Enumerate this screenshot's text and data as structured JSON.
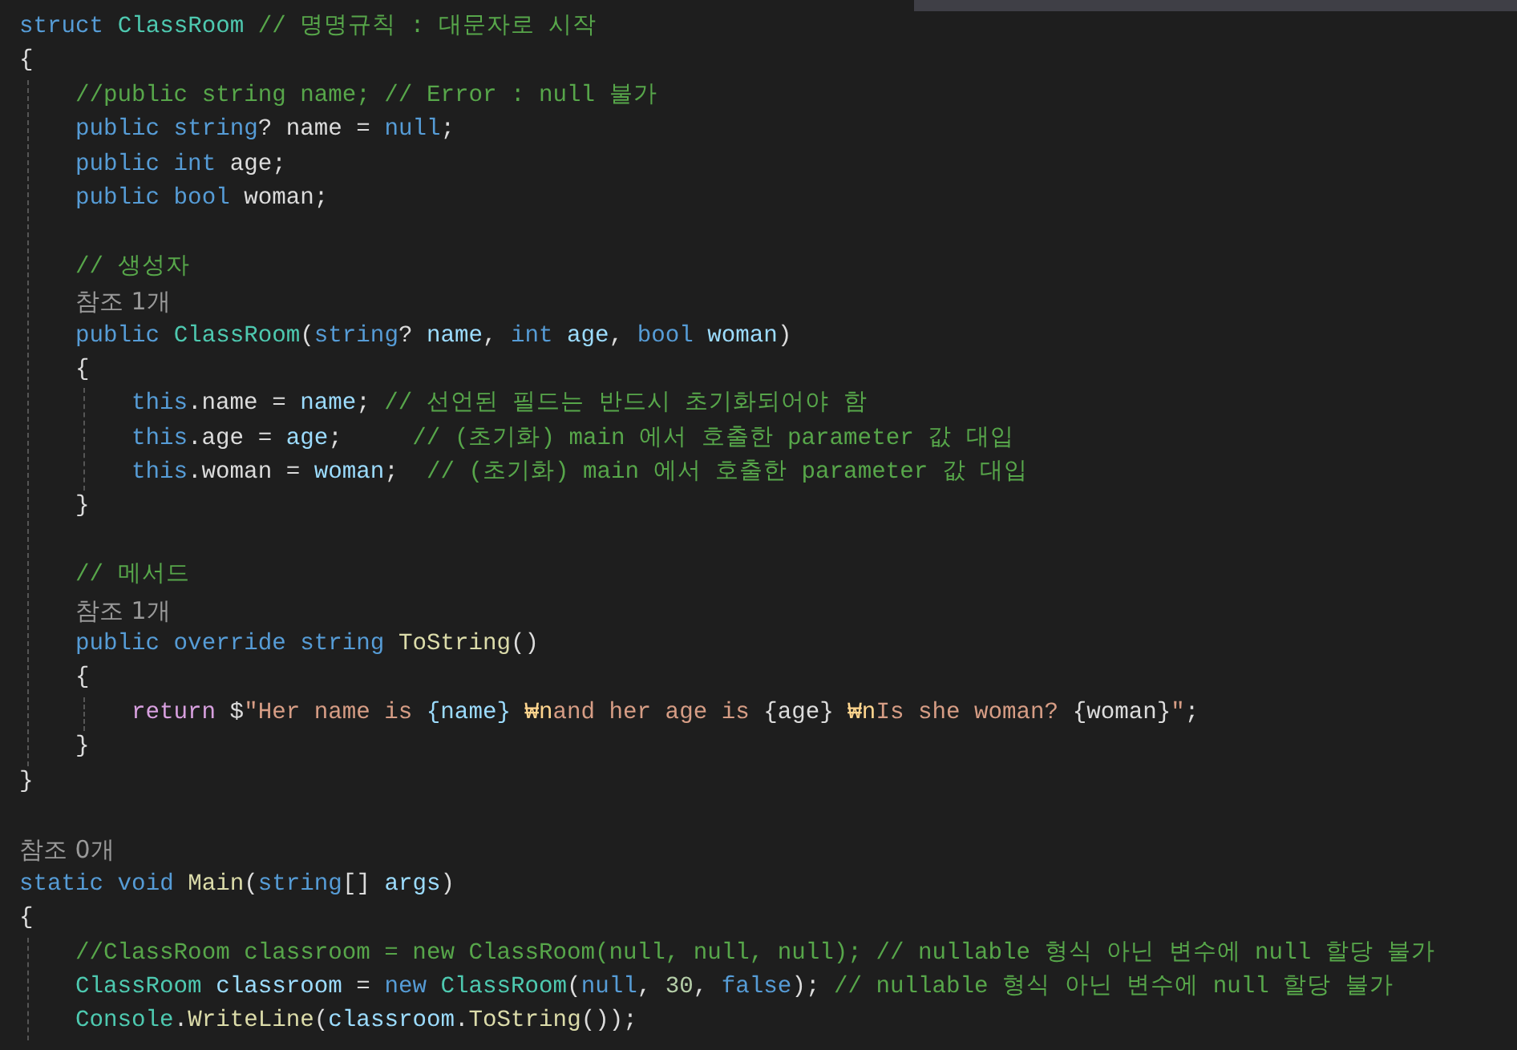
{
  "editor": {
    "lines": [
      {
        "kind": "code",
        "tokens": [
          {
            "kind": "kw",
            "text": "struct "
          },
          {
            "kind": "type",
            "text": "ClassRoom"
          },
          {
            "kind": "comment",
            "text": " // 명명규칙 : 대문자로 시작"
          }
        ]
      },
      {
        "kind": "code",
        "tokens": [
          {
            "kind": "plain",
            "text": "{"
          }
        ],
        "children": [
          {
            "kind": "code",
            "tokens": [
              {
                "kind": "comment",
                "text": "//public string name; // Error : null 불가"
              }
            ]
          },
          {
            "kind": "code",
            "tokens": [
              {
                "kind": "kw",
                "text": "public string"
              },
              {
                "kind": "plain",
                "text": "? name = "
              },
              {
                "kind": "kw",
                "text": "null"
              },
              {
                "kind": "plain",
                "text": ";"
              }
            ]
          },
          {
            "kind": "code",
            "tokens": [
              {
                "kind": "kw",
                "text": "public int"
              },
              {
                "kind": "plain",
                "text": " age;"
              }
            ]
          },
          {
            "kind": "code",
            "tokens": [
              {
                "kind": "kw",
                "text": "public bool"
              },
              {
                "kind": "plain",
                "text": " woman;"
              }
            ]
          },
          {
            "kind": "blank"
          },
          {
            "kind": "code",
            "tokens": [
              {
                "kind": "comment",
                "text": "// 생성자"
              }
            ]
          },
          {
            "kind": "codelens",
            "text": "참조 1개"
          },
          {
            "kind": "code",
            "tokens": [
              {
                "kind": "kw",
                "text": "public "
              },
              {
                "kind": "type",
                "text": "ClassRoom"
              },
              {
                "kind": "plain",
                "text": "("
              },
              {
                "kind": "kw",
                "text": "string"
              },
              {
                "kind": "plain",
                "text": "? "
              },
              {
                "kind": "var",
                "text": "name"
              },
              {
                "kind": "plain",
                "text": ", "
              },
              {
                "kind": "kw",
                "text": "int "
              },
              {
                "kind": "var",
                "text": "age"
              },
              {
                "kind": "plain",
                "text": ", "
              },
              {
                "kind": "kw",
                "text": "bool "
              },
              {
                "kind": "var",
                "text": "woman"
              },
              {
                "kind": "plain",
                "text": ")"
              }
            ]
          },
          {
            "kind": "code",
            "tokens": [
              {
                "kind": "plain",
                "text": "{"
              }
            ],
            "children": [
              {
                "kind": "code",
                "tokens": [
                  {
                    "kind": "kw",
                    "text": "this"
                  },
                  {
                    "kind": "plain",
                    "text": ".name = "
                  },
                  {
                    "kind": "var",
                    "text": "name"
                  },
                  {
                    "kind": "plain",
                    "text": "; "
                  },
                  {
                    "kind": "comment",
                    "text": "// 선언된 필드는 반드시 초기화되어야 함"
                  }
                ]
              },
              {
                "kind": "code",
                "tokens": [
                  {
                    "kind": "kw",
                    "text": "this"
                  },
                  {
                    "kind": "plain",
                    "text": ".age = "
                  },
                  {
                    "kind": "var",
                    "text": "age"
                  },
                  {
                    "kind": "plain",
                    "text": ";     "
                  },
                  {
                    "kind": "comment",
                    "text": "// (초기화) main 에서 호출한 parameter 값 대입"
                  }
                ]
              },
              {
                "kind": "code",
                "tokens": [
                  {
                    "kind": "kw",
                    "text": "this"
                  },
                  {
                    "kind": "plain",
                    "text": ".woman = "
                  },
                  {
                    "kind": "var",
                    "text": "woman"
                  },
                  {
                    "kind": "plain",
                    "text": ";  "
                  },
                  {
                    "kind": "comment",
                    "text": "// (초기화) main 에서 호출한 parameter 값 대입"
                  }
                ]
              }
            ]
          },
          {
            "kind": "code",
            "tokens": [
              {
                "kind": "plain",
                "text": "}"
              }
            ]
          },
          {
            "kind": "blank"
          },
          {
            "kind": "code",
            "tokens": [
              {
                "kind": "comment",
                "text": "// 메서드"
              }
            ]
          },
          {
            "kind": "codelens",
            "text": "참조 1개"
          },
          {
            "kind": "code",
            "tokens": [
              {
                "kind": "kw",
                "text": "public override string "
              },
              {
                "kind": "fn",
                "text": "ToString"
              },
              {
                "kind": "plain",
                "text": "()"
              }
            ]
          },
          {
            "kind": "code",
            "tokens": [
              {
                "kind": "plain",
                "text": "{"
              }
            ],
            "children": [
              {
                "kind": "code",
                "tokens": [
                  {
                    "kind": "ctrl",
                    "text": "return"
                  },
                  {
                    "kind": "plain",
                    "text": " $"
                  },
                  {
                    "kind": "str",
                    "text": "\"Her name is "
                  },
                  {
                    "kind": "var",
                    "text": "{name}"
                  },
                  {
                    "kind": "esc",
                    "text": " ₩n"
                  },
                  {
                    "kind": "str",
                    "text": "and her age is "
                  },
                  {
                    "kind": "plain",
                    "text": "{age}"
                  },
                  {
                    "kind": "esc",
                    "text": " ₩n"
                  },
                  {
                    "kind": "str",
                    "text": "Is she woman? "
                  },
                  {
                    "kind": "plain",
                    "text": "{woman}"
                  },
                  {
                    "kind": "str",
                    "text": "\""
                  },
                  {
                    "kind": "plain",
                    "text": ";"
                  }
                ]
              }
            ]
          },
          {
            "kind": "code",
            "tokens": [
              {
                "kind": "plain",
                "text": "}"
              }
            ]
          }
        ]
      },
      {
        "kind": "code",
        "tokens": [
          {
            "kind": "plain",
            "text": "}"
          }
        ]
      },
      {
        "kind": "blank"
      },
      {
        "kind": "codelens",
        "text": "참조 0개"
      },
      {
        "kind": "code",
        "tokens": [
          {
            "kind": "kw",
            "text": "static void "
          },
          {
            "kind": "fn",
            "text": "Main"
          },
          {
            "kind": "plain",
            "text": "("
          },
          {
            "kind": "kw",
            "text": "string"
          },
          {
            "kind": "plain",
            "text": "[] "
          },
          {
            "kind": "var",
            "text": "args"
          },
          {
            "kind": "plain",
            "text": ")"
          }
        ]
      },
      {
        "kind": "code",
        "tokens": [
          {
            "kind": "plain",
            "text": "{"
          }
        ],
        "children": [
          {
            "kind": "code",
            "tokens": [
              {
                "kind": "comment",
                "text": "//ClassRoom classroom = new ClassRoom(null, null, null); // nullable 형식 아닌 변수에 null 할당 불가"
              }
            ]
          },
          {
            "kind": "code",
            "tokens": [
              {
                "kind": "type",
                "text": "ClassRoom"
              },
              {
                "kind": "var",
                "text": " classroom"
              },
              {
                "kind": "plain",
                "text": " = "
              },
              {
                "kind": "kw",
                "text": "new "
              },
              {
                "kind": "type",
                "text": "ClassRoom"
              },
              {
                "kind": "plain",
                "text": "("
              },
              {
                "kind": "kw",
                "text": "null"
              },
              {
                "kind": "plain",
                "text": ", "
              },
              {
                "kind": "num",
                "text": "30"
              },
              {
                "kind": "plain",
                "text": ", "
              },
              {
                "kind": "kw",
                "text": "false"
              },
              {
                "kind": "plain",
                "text": "); "
              },
              {
                "kind": "comment",
                "text": "// nullable 형식 아닌 변수에 null 할당 불가"
              }
            ]
          },
          {
            "kind": "code",
            "tokens": [
              {
                "kind": "type",
                "text": "Console"
              },
              {
                "kind": "plain",
                "text": "."
              },
              {
                "kind": "fn",
                "text": "WriteLine"
              },
              {
                "kind": "plain",
                "text": "("
              },
              {
                "kind": "var",
                "text": "classroom"
              },
              {
                "kind": "plain",
                "text": "."
              },
              {
                "kind": "fn",
                "text": "ToString"
              },
              {
                "kind": "plain",
                "text": "());"
              }
            ]
          }
        ]
      }
    ]
  }
}
